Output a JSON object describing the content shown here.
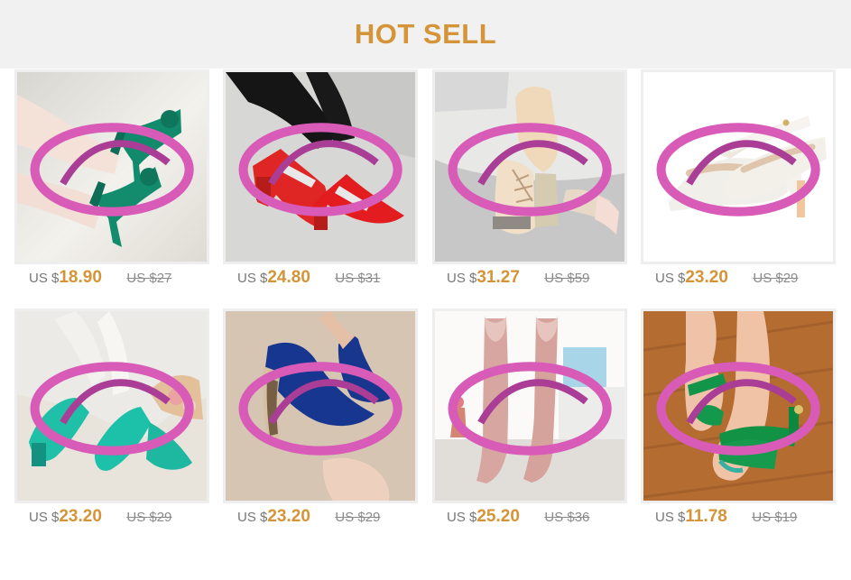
{
  "banner": {
    "title": "HOT SELL"
  },
  "colors": {
    "banner_bg": "#f1f1f1",
    "accent": "#d49437",
    "muted_text": "#777777",
    "card_border": "#eeeeee"
  },
  "products": [
    {
      "currency": "US $",
      "price": "18.90",
      "old_price": "US $27",
      "icon": "green-peep-toe-heels-image"
    },
    {
      "currency": "US $",
      "price": "24.80",
      "old_price": "US $31",
      "icon": "red-pointed-flats-image"
    },
    {
      "currency": "US $",
      "price": "31.27",
      "old_price": "US $59",
      "icon": "beige-lace-up-boots-image"
    },
    {
      "currency": "US $",
      "price": "23.20",
      "old_price": "US $29",
      "icon": "white-mary-jane-pumps-image"
    },
    {
      "currency": "US $",
      "price": "23.20",
      "old_price": "US $29",
      "icon": "teal-patent-pumps-image"
    },
    {
      "currency": "US $",
      "price": "23.20",
      "old_price": "US $29",
      "icon": "blue-wedge-pumps-image"
    },
    {
      "currency": "US $",
      "price": "25.20",
      "old_price": "US $36",
      "icon": "pink-thigh-high-boots-image"
    },
    {
      "currency": "US $",
      "price": "11.78",
      "old_price": "US $19",
      "icon": "green-flat-sandals-image"
    }
  ]
}
